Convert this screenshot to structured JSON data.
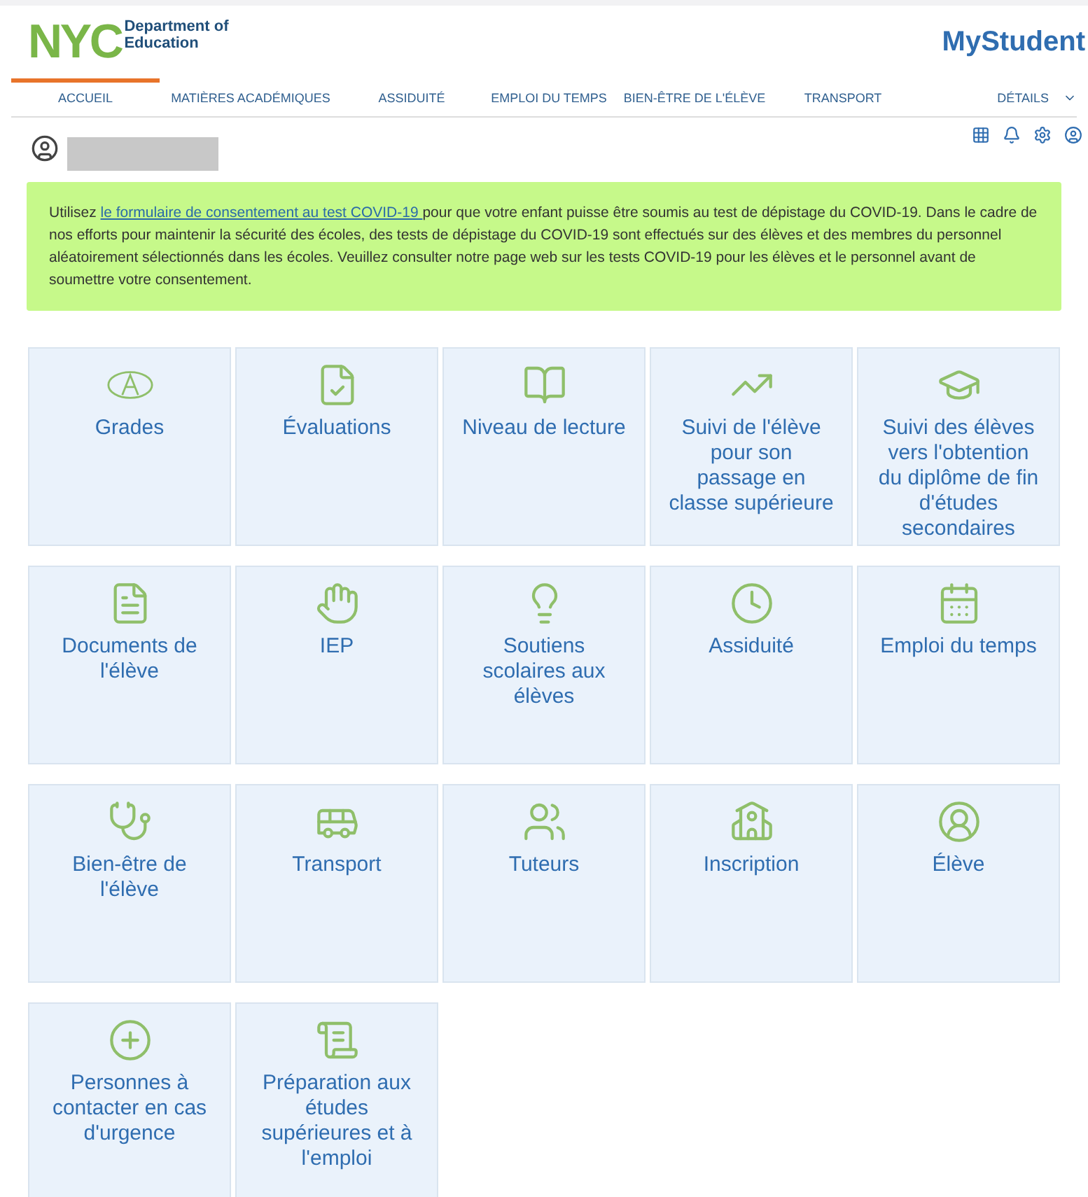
{
  "header": {
    "logo_text": "NYC",
    "org": "Department of",
    "org_line2": "Education",
    "app_title": "MyStudent"
  },
  "nav": [
    {
      "label": "ACCUEIL",
      "selected": true
    },
    {
      "label": "MATIÈRES ACADÉMIQUES",
      "selected": false
    },
    {
      "label": "ASSIDUITÉ",
      "selected": false
    },
    {
      "label": "EMPLOI DU TEMPS",
      "selected": false
    },
    {
      "label": "BIEN-ÊTRE DE L'ÉLÈVE",
      "selected": false
    },
    {
      "label": "TRANSPORT",
      "selected": false
    },
    {
      "label": "DÉTAILS",
      "selected": false
    }
  ],
  "banner": {
    "before": "Utilisez ",
    "link": "le formulaire de consentement au test COVID-19 ",
    "after": "pour que votre enfant puisse être soumis au test de dépistage du COVID-19. Dans le cadre de nos efforts pour maintenir la sécurité des écoles, des tests de dépistage du COVID-19 sont effectués sur des élèves et des membres du personnel aléatoirement sélectionnés dans les écoles. Veuillez consulter notre page web sur les tests COVID-19 pour les élèves et le personnel avant de soumettre votre consentement."
  },
  "tiles": [
    {
      "label": "Grades"
    },
    {
      "label": "Évaluations"
    },
    {
      "label": "Niveau de lecture"
    },
    {
      "label": "Suivi de l'élève pour  son passage en classe supérieure"
    },
    {
      "label": "Suivi des élèves vers l'obtention du diplôme de fin d'études secondaires"
    },
    {
      "label": "Documents de l'élève"
    },
    {
      "label": "IEP"
    },
    {
      "label": "Soutiens scolaires aux élèves"
    },
    {
      "label": "Assiduité"
    },
    {
      "label": "Emploi du temps"
    },
    {
      "label": "Bien-être de l'élève"
    },
    {
      "label": "Transport"
    },
    {
      "label": "Tuteurs"
    },
    {
      "label": "Inscription"
    },
    {
      "label": "Élève"
    },
    {
      "label": "Personnes à contacter en cas d'urgence"
    },
    {
      "label": "Préparation aux études supérieures et à l'emploi"
    }
  ]
}
